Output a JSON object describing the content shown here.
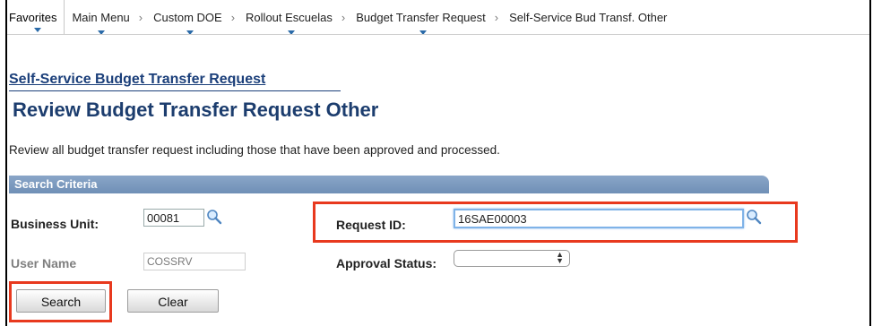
{
  "breadcrumb": {
    "favorites": "Favorites",
    "items": [
      "Main Menu",
      "Custom DOE",
      "Rollout Escuelas",
      "Budget Transfer Request",
      "Self-Service Bud Transf. Other"
    ],
    "separator": "›"
  },
  "page": {
    "link_title": "Self-Service Budget Transfer Request",
    "title": "Review Budget Transfer Request Other",
    "description": "Review all budget transfer request including those that have been approved and processed."
  },
  "search_criteria": {
    "header": "Search Criteria",
    "business_unit": {
      "label": "Business Unit:",
      "value": "00081"
    },
    "request_id": {
      "label": "Request ID:",
      "value": "16SAE00003"
    },
    "user_name": {
      "label": "User Name",
      "value": "COSSRV"
    },
    "approval_status": {
      "label": "Approval Status:",
      "value": ""
    }
  },
  "buttons": {
    "search": "Search",
    "clear": "Clear"
  },
  "colors": {
    "accent": "#1b3f7a",
    "highlight": "#e8391e",
    "section_bar": "#7b98be"
  }
}
